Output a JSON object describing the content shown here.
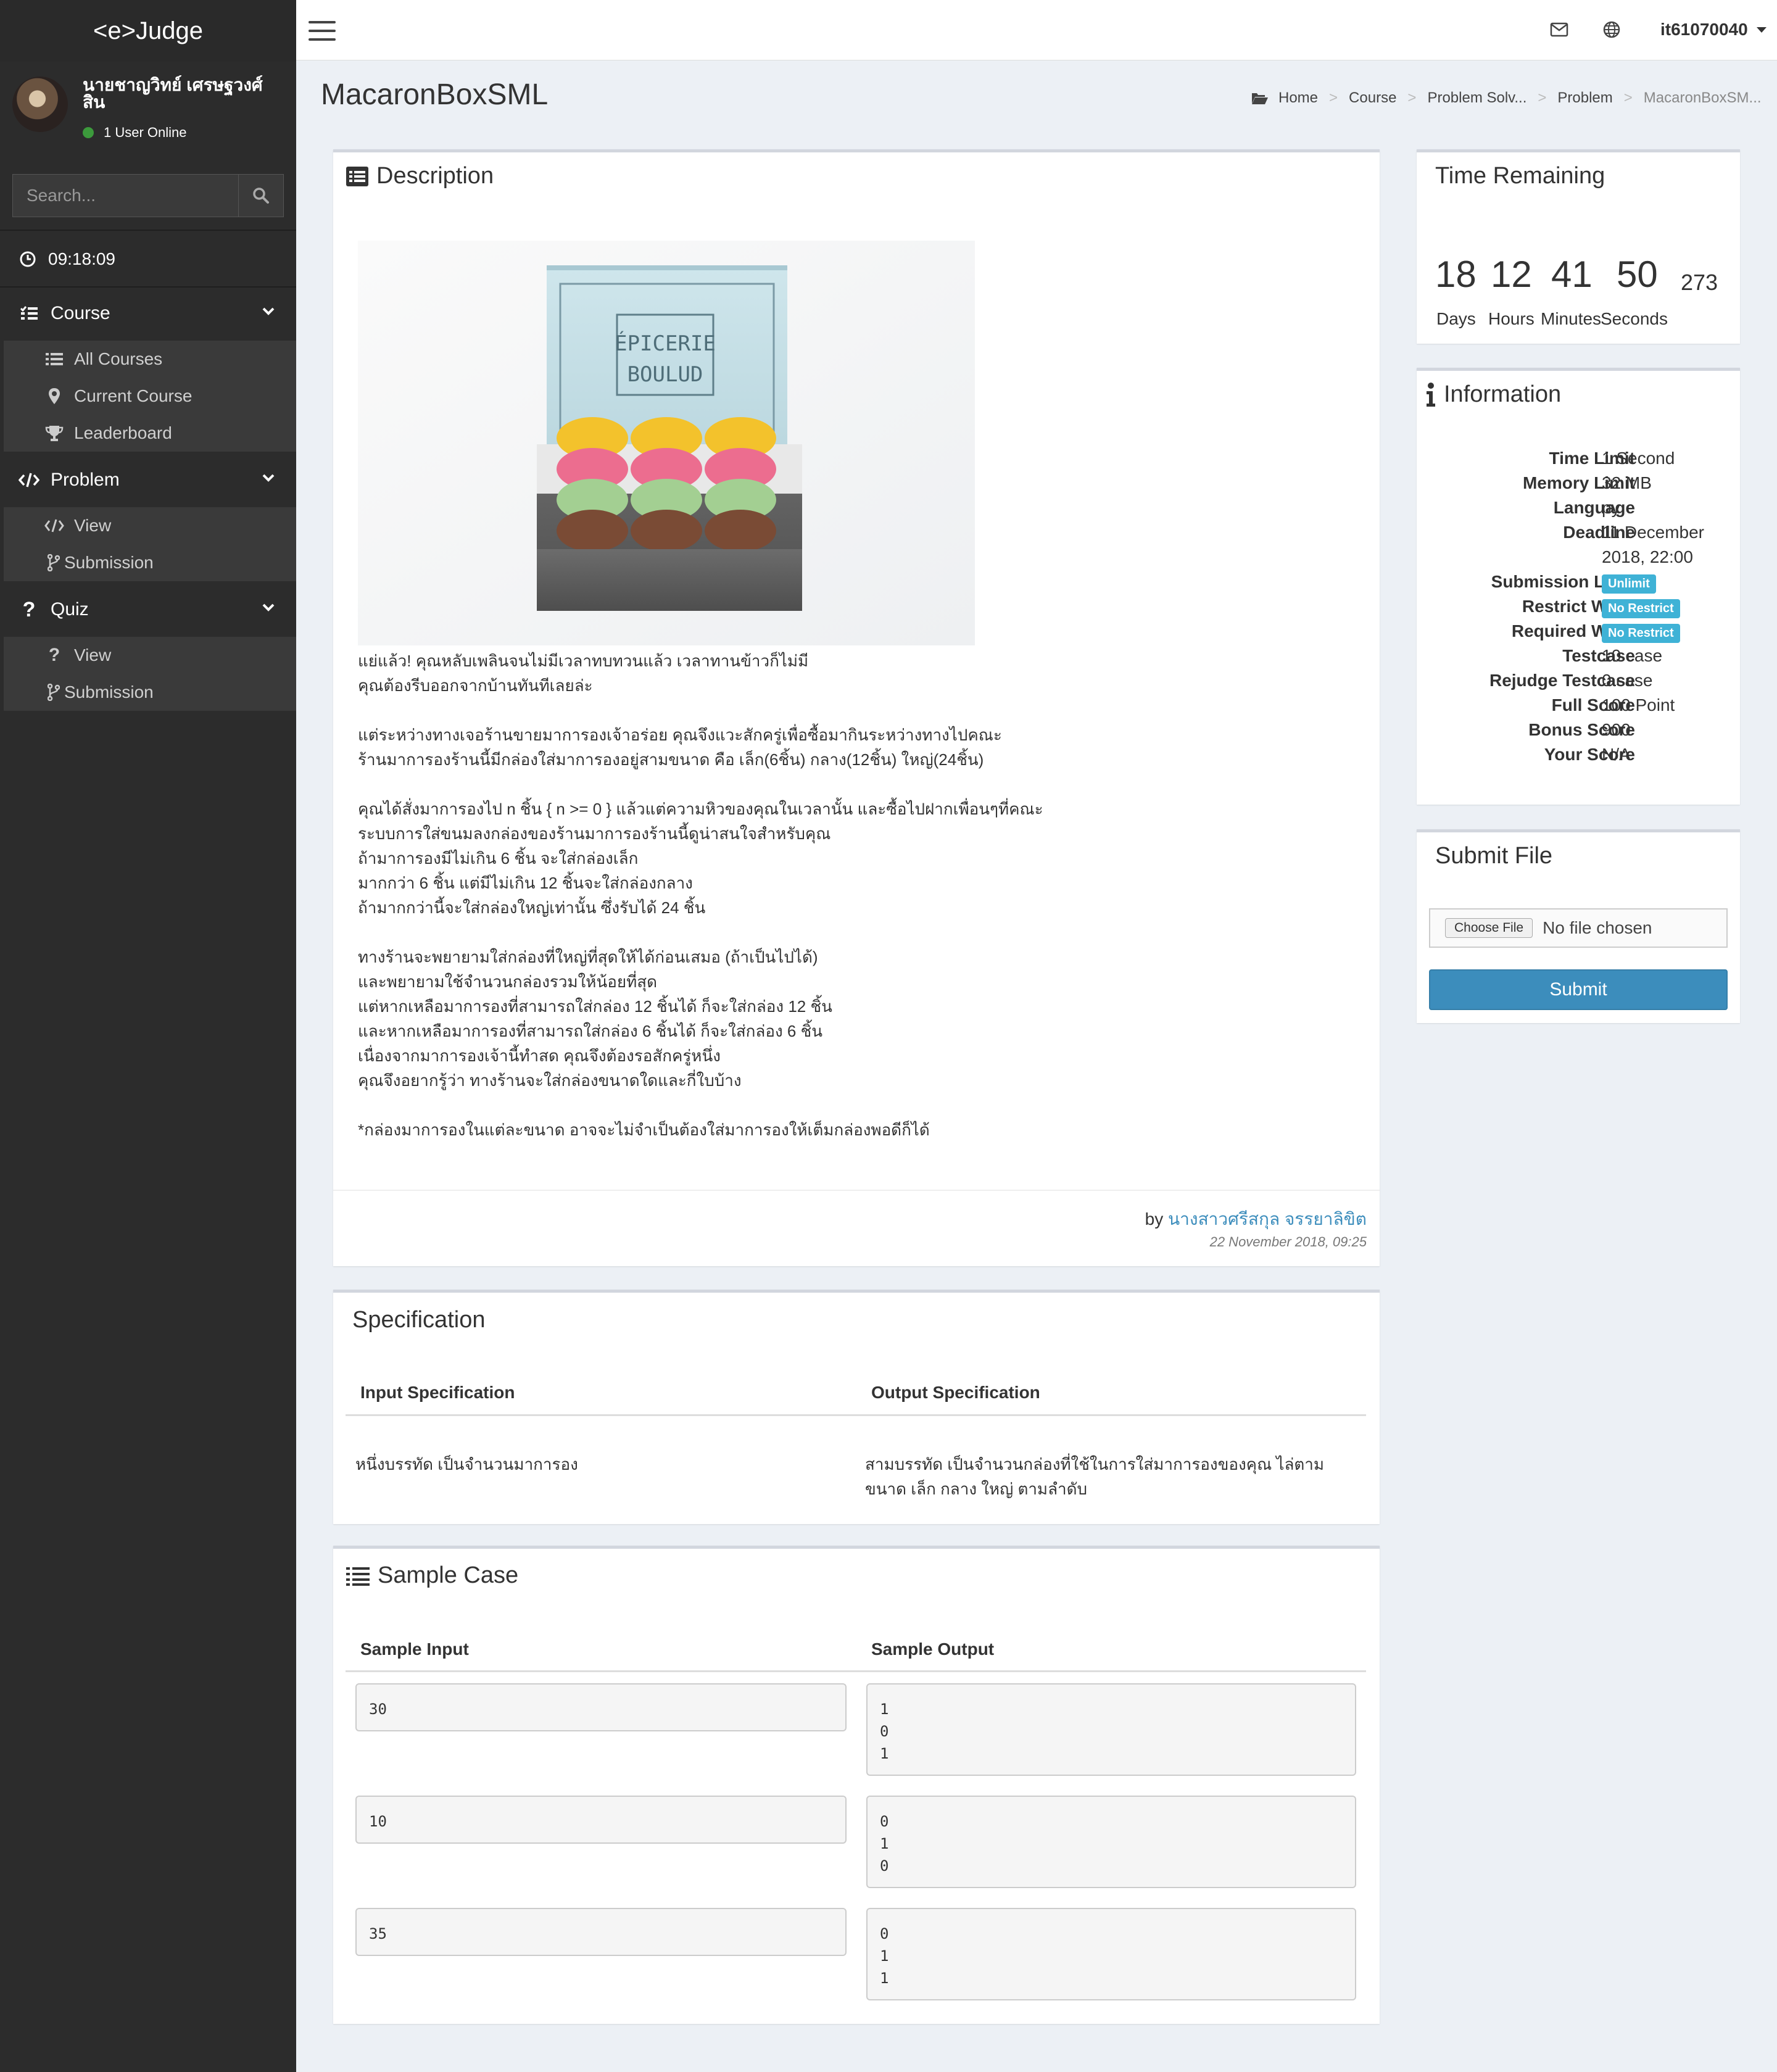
{
  "app": {
    "logo": "<e>Judge"
  },
  "user": {
    "name": "นายชาญวิทย์ เศรษฐวงศ์สิน",
    "online": "1 User Online",
    "account": "it61070040"
  },
  "search": {
    "placeholder": "Search..."
  },
  "clock": "09:18:09",
  "nav": {
    "course": {
      "label": "Course",
      "items": [
        "All Courses",
        "Current Course",
        "Leaderboard"
      ]
    },
    "problem": {
      "label": "Problem",
      "items": [
        "View",
        "Submission"
      ]
    },
    "quiz": {
      "label": "Quiz",
      "items": [
        "View",
        "Submission"
      ]
    }
  },
  "page": {
    "title": "MacaronBoxSML"
  },
  "breadcrumb": [
    "Home",
    "Course",
    "Problem Solv...",
    "Problem",
    "MacaronBoxSM..."
  ],
  "description": {
    "title": "Description",
    "image_text": {
      "brand1": "ÉPICERIE",
      "brand2": "BOULUD"
    },
    "lines": [
      "แย่แล้ว! คุณหลับเพลินจนไม่มีเวลาทบทวนแล้ว เวลาทานข้าวก็ไม่มี",
      "คุณต้องรีบออกจากบ้านทันทีเลยล่ะ",
      "",
      "แต่ระหว่างทางเจอร้านขายมาการองเจ้าอร่อย คุณจึงแวะสักครู่เพื่อซื้อมากินระหว่างทางไปคณะ",
      "ร้านมาการองร้านนี้มีกล่องใส่มาการองอยู่สามขนาด คือ เล็ก(6ชิ้น) กลาง(12ชิ้น) ใหญ่(24ชิ้น)",
      "",
      "คุณได้สั่งมาการองไป n ชิ้น { n >= 0 } แล้วแต่ความหิวของคุณในเวลานั้น และซื้อไปฝากเพื่อนๆที่คณะ",
      "ระบบการใส่ขนมลงกล่องของร้านมาการองร้านนี้ดูน่าสนใจสำหรับคุณ",
      "ถ้ามาการองมีไม่เกิน 6 ชิ้น จะใส่กล่องเล็ก",
      "มากกว่า 6 ชิ้น แต่มีไม่เกิน 12 ชิ้นจะใส่กล่องกลาง",
      "ถ้ามากกว่านี้จะใส่กล่องใหญ่เท่านั้น ซึ่งรับได้ 24 ชิ้น",
      "",
      "ทางร้านจะพยายามใส่กล่องที่ใหญ่ที่สุดให้ได้ก่อนเสมอ (ถ้าเป็นไปได้)",
      "และพยายามใช้จำนวนกล่องรวมให้น้อยที่สุด",
      "แต่หากเหลือมาการองที่สามารถใส่กล่อง 12 ชิ้นได้ ก็จะใส่กล่อง 12 ชิ้น",
      "และหากเหลือมาการองที่สามารถใส่กล่อง 6 ชิ้นได้ ก็จะใส่กล่อง 6 ชิ้น",
      "เนื่องจากมาการองเจ้านี้ทำสด คุณจึงต้องรอสักครู่หนึ่ง",
      "คุณจึงอยากรู้ว่า ทางร้านจะใส่กล่องขนาดใดและกี่ใบบ้าง",
      "",
      "*กล่องมาการองในแต่ละขนาด อาจจะไม่จำเป็นต้องใส่มาการองให้เต็มกล่องพอดีก็ได้"
    ],
    "by": "by",
    "author": "นางสาวศรีสกุล จรรยาลิขิต",
    "date": "22 November 2018, 09:25"
  },
  "specification": {
    "title": "Specification",
    "input_header": "Input Specification",
    "output_header": "Output Specification",
    "input": "หนึ่งบรรทัด เป็นจำนวนมาการอง",
    "output_line1": "สามบรรทัด เป็นจำนวนกล่องที่ใช้ในการใส่มาการองของคุณ ไล่ตาม",
    "output_line2": "ขนาด เล็ก กลาง ใหญ่ ตามลำดับ"
  },
  "samples": {
    "title": "Sample Case",
    "input_header": "Sample Input",
    "output_header": "Sample Output",
    "cases": [
      {
        "input": "30",
        "output": "1\n0\n1"
      },
      {
        "input": "10",
        "output": "0\n1\n0"
      },
      {
        "input": "35",
        "output": "0\n1\n1"
      }
    ]
  },
  "time_remaining": {
    "title": "Time Remaining",
    "days": "18",
    "hours": "12",
    "minutes": "41",
    "seconds": "50",
    "ms": "273",
    "labels": [
      "Days",
      "Hours",
      "Minutes",
      "Seconds"
    ]
  },
  "information": {
    "title": "Information",
    "rows": [
      {
        "label": "Time Limit",
        "value": "1 Second"
      },
      {
        "label": "Memory Limit",
        "value": "32 MB"
      },
      {
        "label": "Language",
        "value": "py"
      },
      {
        "label": "Deadline",
        "value": "11 December"
      },
      {
        "label": "",
        "value": "2018, 22:00"
      },
      {
        "label": "Submission Limit",
        "value": "Unlimit"
      },
      {
        "label": "Restrict Word",
        "value": "No Restrict"
      },
      {
        "label": "Required Word",
        "value": "No Restrict"
      },
      {
        "label": "Testcase",
        "value": "10 case"
      },
      {
        "label": "Rejudge Testcase",
        "value": "0 case"
      },
      {
        "label": "Full Score",
        "value": "100 Point"
      },
      {
        "label": "Bonus Score",
        "value": "900"
      },
      {
        "label": "Your Score",
        "value": "N/A"
      }
    ]
  },
  "submit": {
    "title": "Submit File",
    "choose": "Choose File",
    "no_file": "No file chosen",
    "button": "Submit"
  },
  "colors": {
    "accent": "#3c8dbc",
    "badge": "#3fb2d6",
    "sidebar": "#2c2c2c"
  }
}
